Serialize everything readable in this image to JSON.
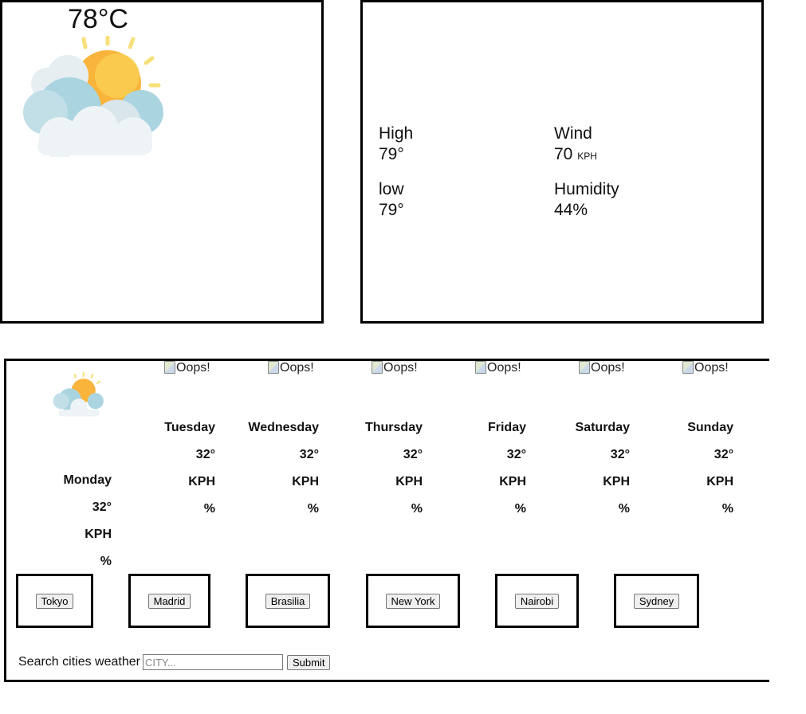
{
  "current": {
    "temperature": "78°C",
    "icon": "partly-cloudy-sun-icon"
  },
  "details": {
    "high_label": "High",
    "high_value": "79°",
    "low_label": "low",
    "low_value": "79°",
    "wind_label": "Wind",
    "wind_value": "70",
    "wind_unit": "KPH",
    "humidity_label": "Humidity",
    "humidity_value": "44%"
  },
  "forecast": {
    "broken_image_alt": "Oops!",
    "days": [
      {
        "name": "Monday",
        "temp": "32°",
        "wind": "KPH",
        "humidity": "%"
      },
      {
        "name": "Tuesday",
        "temp": "32°",
        "wind": "KPH",
        "humidity": "%"
      },
      {
        "name": "Wednesday",
        "temp": "32°",
        "wind": "KPH",
        "humidity": "%"
      },
      {
        "name": "Thursday",
        "temp": "32°",
        "wind": "KPH",
        "humidity": "%"
      },
      {
        "name": "Friday",
        "temp": "32°",
        "wind": "KPH",
        "humidity": "%"
      },
      {
        "name": "Saturday",
        "temp": "32°",
        "wind": "KPH",
        "humidity": "%"
      },
      {
        "name": "Sunday",
        "temp": "32°",
        "wind": "KPH",
        "humidity": "%"
      }
    ]
  },
  "cities": [
    "Tokyo",
    "Madrid",
    "Brasilia",
    "New York",
    "Nairobi",
    "Sydney"
  ],
  "search": {
    "label": "Search cities weather",
    "placeholder": "CITY...",
    "submit_label": "Submit"
  }
}
